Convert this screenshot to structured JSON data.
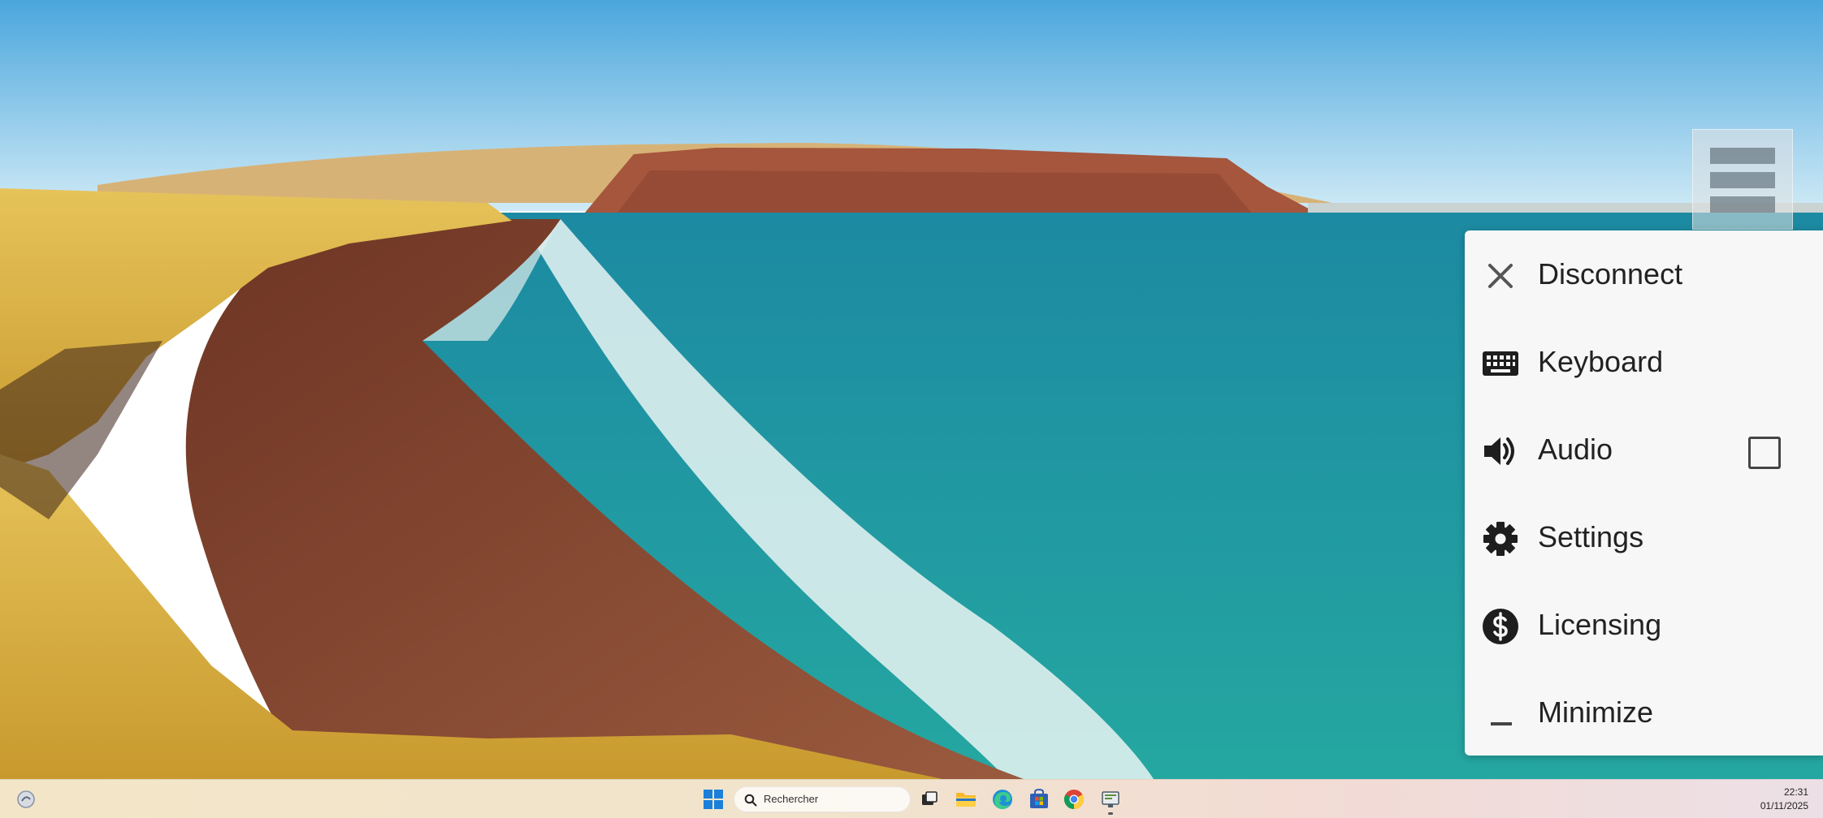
{
  "menu": {
    "items": [
      {
        "label": "Disconnect",
        "icon": "close-icon"
      },
      {
        "label": "Keyboard",
        "icon": "keyboard-icon"
      },
      {
        "label": "Audio",
        "icon": "volume-icon",
        "checked": false
      },
      {
        "label": "Settings",
        "icon": "gear-icon"
      },
      {
        "label": "Licensing",
        "icon": "dollar-icon"
      },
      {
        "label": "Minimize",
        "icon": "minimize-icon"
      }
    ]
  },
  "taskbar": {
    "search_placeholder": "Rechercher",
    "apps": [
      "start-icon",
      "task-view-icon",
      "file-explorer-icon",
      "edge-icon",
      "store-icon",
      "chrome-icon",
      "remote-app-icon"
    ],
    "time": "22:31",
    "date": "01/11/2025"
  },
  "colors": {
    "sky": "#7cc4ea",
    "sea": "#1b9a9a",
    "sand": "#8a4a32",
    "cliff": "#d9b24a",
    "menu_bg": "#f7f7f7"
  }
}
